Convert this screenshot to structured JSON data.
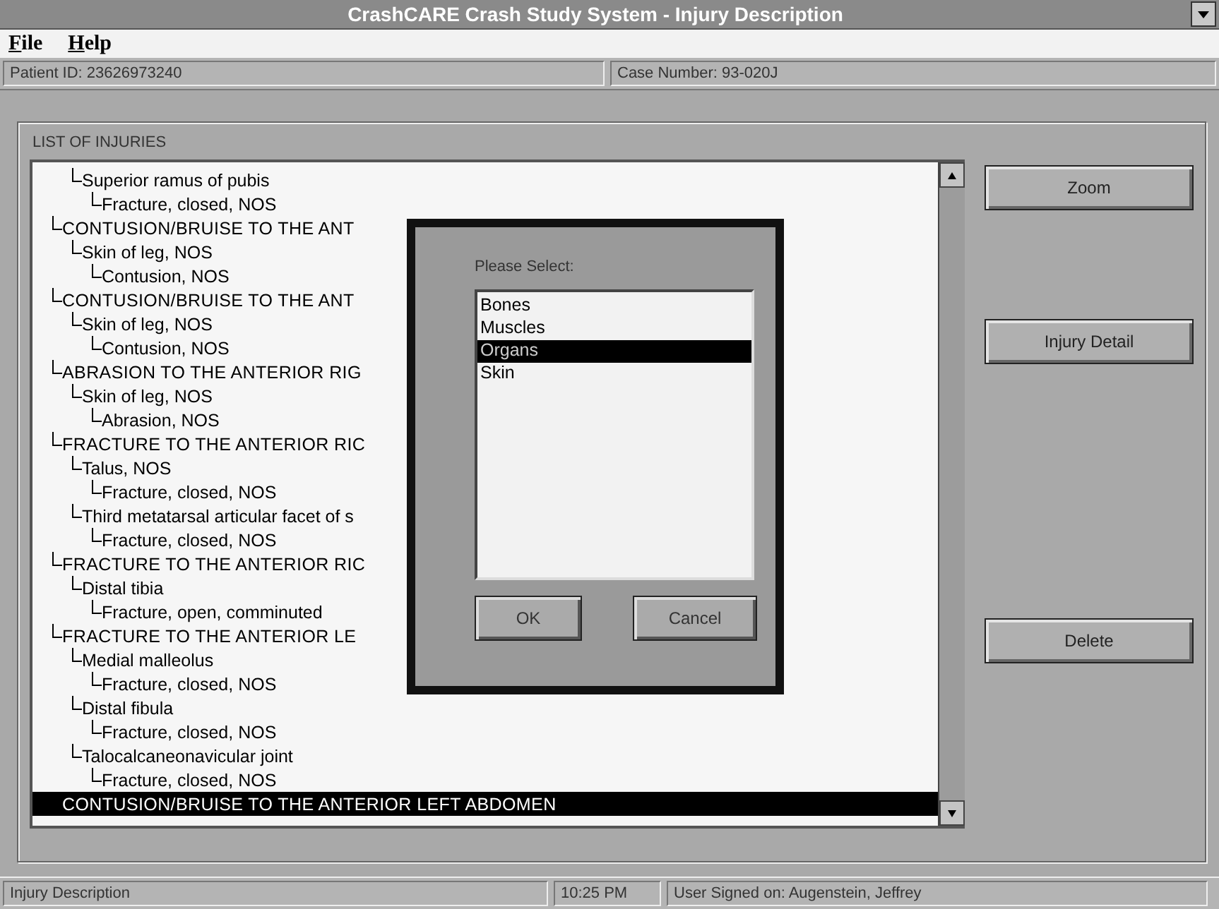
{
  "window": {
    "title": "CrashCARE Crash Study System - Injury Description"
  },
  "menu": [
    "File",
    "Help"
  ],
  "info_bar": {
    "patient_id": "Patient ID:  23626973240",
    "case_number": "Case Number:  93-020J"
  },
  "injury_list": {
    "title": "LIST OF INJURIES",
    "items": [
      {
        "kind": "continued",
        "label": "Superior ramus of pubis",
        "selected": false,
        "children": [
          {
            "label": "Fracture, closed, NOS",
            "selected": false
          }
        ]
      },
      {
        "kind": "injury",
        "label": "CONTUSION/BRUISE TO THE ANT",
        "selected": false,
        "children": [
          {
            "label": "Skin of leg, NOS",
            "selected": false,
            "children": [
              {
                "label": "Contusion, NOS",
                "selected": false
              }
            ]
          }
        ]
      },
      {
        "kind": "injury",
        "label": "CONTUSION/BRUISE TO THE ANT",
        "selected": false,
        "children": [
          {
            "label": "Skin of leg, NOS",
            "selected": false,
            "children": [
              {
                "label": "Contusion, NOS",
                "selected": false
              }
            ]
          }
        ]
      },
      {
        "kind": "injury",
        "label": "ABRASION TO THE ANTERIOR RIG",
        "selected": false,
        "children": [
          {
            "label": "Skin of leg, NOS",
            "selected": false,
            "children": [
              {
                "label": "Abrasion, NOS",
                "selected": false
              }
            ]
          }
        ]
      },
      {
        "kind": "injury",
        "label": "FRACTURE TO THE ANTERIOR RIC",
        "selected": false,
        "children": [
          {
            "label": "Talus, NOS",
            "selected": false,
            "children": [
              {
                "label": "Fracture, closed, NOS",
                "selected": false
              }
            ]
          },
          {
            "label": "Third metatarsal articular facet of s",
            "selected": false,
            "children": [
              {
                "label": "Fracture, closed, NOS",
                "selected": false
              }
            ]
          }
        ]
      },
      {
        "kind": "injury",
        "label": "FRACTURE TO THE ANTERIOR RIC",
        "selected": false,
        "children": [
          {
            "label": "Distal tibia",
            "selected": false,
            "children": [
              {
                "label": "Fracture, open, comminuted",
                "selected": false
              }
            ]
          }
        ]
      },
      {
        "kind": "injury",
        "label": "FRACTURE TO THE ANTERIOR LE",
        "selected": false,
        "children": [
          {
            "label": "Medial malleolus",
            "selected": false,
            "children": [
              {
                "label": "Fracture, closed, NOS",
                "selected": false
              }
            ]
          },
          {
            "label": "Distal fibula",
            "selected": false,
            "children": [
              {
                "label": "Fracture, closed, NOS",
                "selected": false
              }
            ]
          },
          {
            "label": "Talocalcaneonavicular joint",
            "selected": false,
            "children": [
              {
                "label": "Fracture, closed, NOS",
                "selected": false
              }
            ]
          }
        ]
      },
      {
        "kind": "injury",
        "label": "CONTUSION/BRUISE TO THE ANTERIOR LEFT ABDOMEN",
        "selected": true
      }
    ]
  },
  "buttons": [
    "Zoom",
    "Injury Detail",
    "Delete"
  ],
  "dialog": {
    "prompt": "Please Select:",
    "options": [
      {
        "label": "Bones",
        "selected": false
      },
      {
        "label": "Muscles",
        "selected": false
      },
      {
        "label": "Organs",
        "selected": true
      },
      {
        "label": "Skin",
        "selected": false
      }
    ],
    "buttons": [
      "OK",
      "Cancel"
    ]
  },
  "status_bar": [
    "Injury Description",
    "10:25 PM",
    "User Signed on: Augenstein, Jeffrey"
  ]
}
